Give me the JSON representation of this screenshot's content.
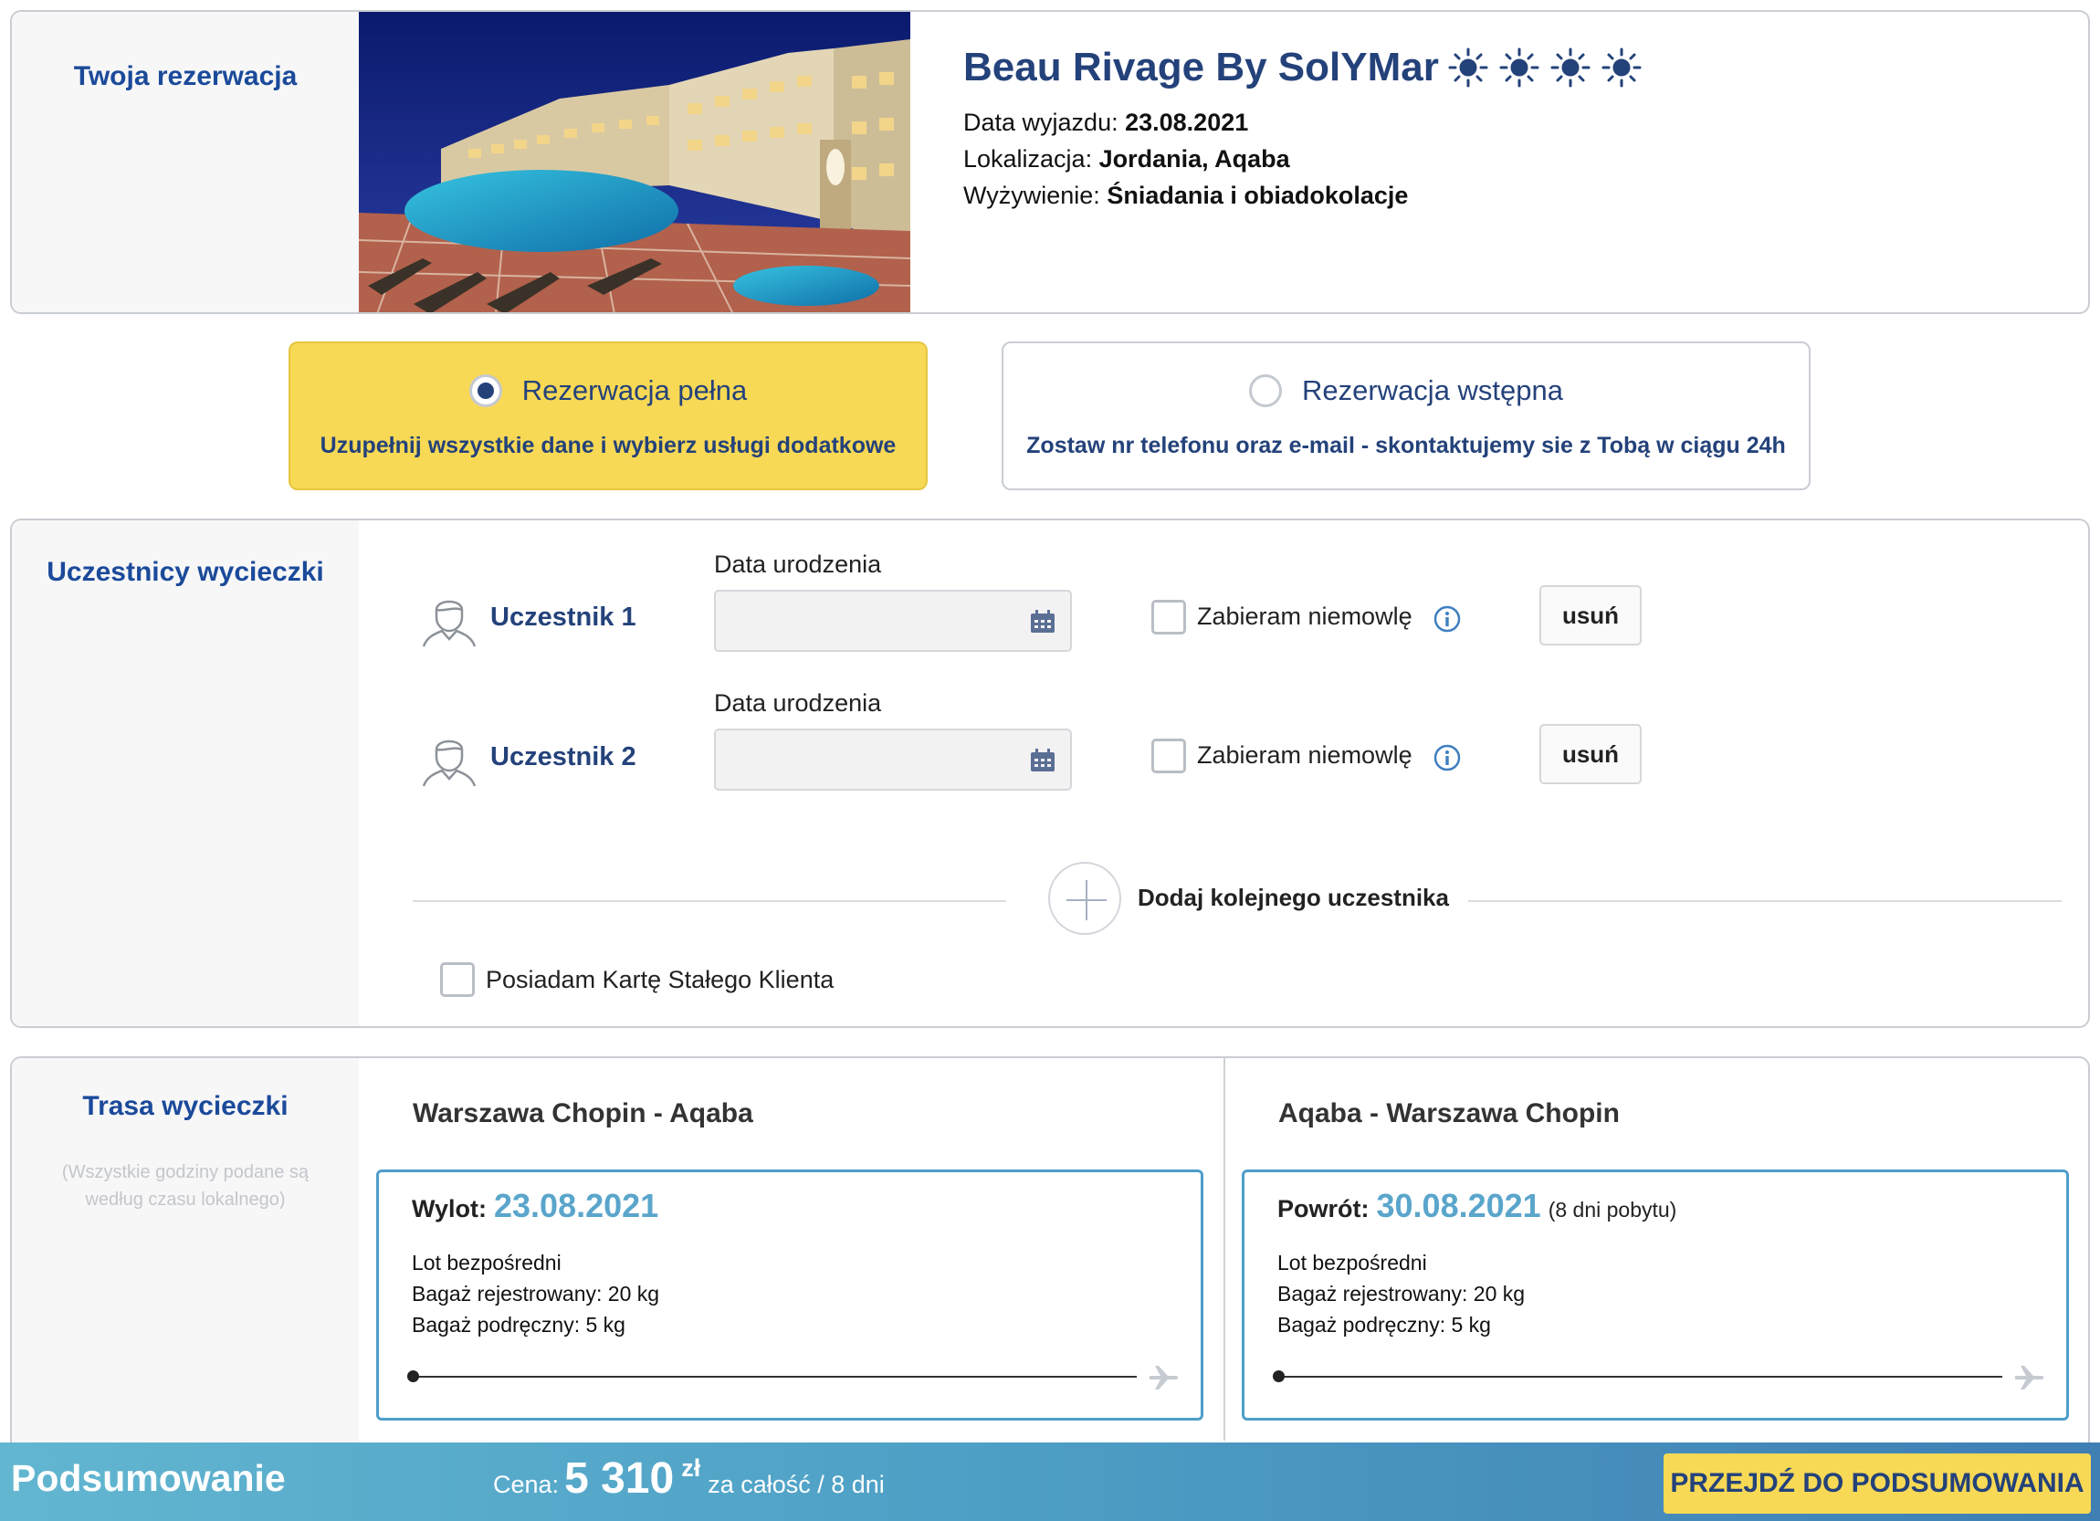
{
  "reservation": {
    "section_title": "Twoja rezerwacja",
    "hotel_name": "Beau Rivage By SolYMar",
    "stars": 4,
    "departure_label": "Data wyjazdu:",
    "departure_value": "23.08.2021",
    "location_label": "Lokalizacja:",
    "location_value": "Jordania, Aqaba",
    "board_label": "Wyżywienie:",
    "board_value": "Śniadania i obiadokolacje"
  },
  "booking_type": {
    "full": {
      "title": "Rezerwacja pełna",
      "subtitle": "Uzupełnij wszystkie dane i wybierz usługi dodatkowe",
      "selected": true
    },
    "preliminary": {
      "title": "Rezerwacja wstępna",
      "subtitle": "Zostaw nr telefonu oraz e-mail - skontaktujemy sie z Tobą w ciągu 24h",
      "selected": false
    }
  },
  "participants": {
    "section_title": "Uczestnicy wycieczki",
    "items": [
      {
        "name": "Uczestnik 1",
        "dob_label": "Data urodzenia",
        "dob_value": "",
        "infant_label": "Zabieram niemowlę",
        "remove_label": "usuń"
      },
      {
        "name": "Uczestnik 2",
        "dob_label": "Data urodzenia",
        "dob_value": "",
        "infant_label": "Zabieram niemowlę",
        "remove_label": "usuń"
      }
    ],
    "add_label": "Dodaj kolejnego uczestnika",
    "loyalty_label": "Posiadam Kartę Stałego Klienta"
  },
  "route": {
    "section_title": "Trasa wycieczki",
    "note": "(Wszystkie godziny podane są według czasu lokalnego)",
    "outbound": {
      "title": "Warszawa Chopin - Aqaba",
      "label": "Wylot:",
      "date": "23.08.2021",
      "extra": "",
      "lines": [
        "Lot bezpośredni",
        "Bagaż rejestrowany: 20 kg",
        "Bagaż podręczny: 5 kg"
      ]
    },
    "inbound": {
      "title": "Aqaba - Warszawa Chopin",
      "label": "Powrót:",
      "date": "30.08.2021",
      "extra": "(8 dni pobytu)",
      "lines": [
        "Lot bezpośredni",
        "Bagaż rejestrowany: 20 kg",
        "Bagaż podręczny: 5 kg"
      ]
    }
  },
  "summary": {
    "title": "Podsumowanie",
    "price_label": "Cena:",
    "price_value": "5 310",
    "currency": "zł",
    "price_note": "za całość / 8 dni",
    "cta": "PRZEJDŹ DO PODSUMOWANIA"
  },
  "colors": {
    "brand_navy": "#24427a",
    "accent_yellow": "#f8d955",
    "accent_blue": "#5aa5cb"
  }
}
